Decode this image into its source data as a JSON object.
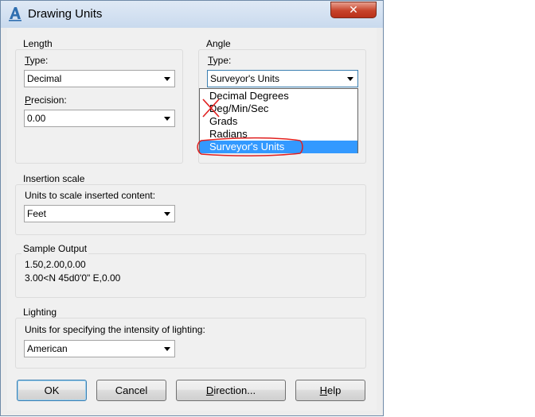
{
  "window": {
    "title": "Drawing Units",
    "close_glyph": "✕"
  },
  "length": {
    "group_label": "Length",
    "type_label_prefix": "T",
    "type_label_rest": "ype:",
    "type_value": "Decimal",
    "precision_label_prefix": "P",
    "precision_label_rest": "recision:",
    "precision_value": "0.00"
  },
  "angle": {
    "group_label": "Angle",
    "type_label_prefix": "T",
    "type_label_rest": "ype:",
    "type_value": "Surveyor's Units",
    "options": [
      "Decimal Degrees",
      "Deg/Min/Sec",
      "Grads",
      "Radians",
      "Surveyor's Units"
    ],
    "selected_index": 4,
    "struck_option_index": 1,
    "highlighted_option_index": 4
  },
  "insertion": {
    "group_label": "Insertion scale",
    "units_label": "Units to scale inserted content:",
    "units_value": "Feet"
  },
  "sample": {
    "group_label": "Sample Output",
    "line1": "1.50,2.00,0.00",
    "line2": "3.00<N 45d0'0\" E,0.00"
  },
  "lighting": {
    "group_label": "Lighting",
    "units_label": "Units for specifying the intensity of lighting:",
    "units_value": "American"
  },
  "buttons": {
    "ok": "OK",
    "cancel": "Cancel",
    "direction_prefix": "D",
    "direction_rest": "irection...",
    "help_prefix": "H",
    "help_rest": "elp"
  },
  "colors": {
    "selection": "#3399ff",
    "annotation": "#e02020",
    "close": "#c7432a"
  },
  "icons": {
    "app": "autocad-a-icon",
    "close": "close-icon",
    "arrow": "chevron-down-icon"
  }
}
